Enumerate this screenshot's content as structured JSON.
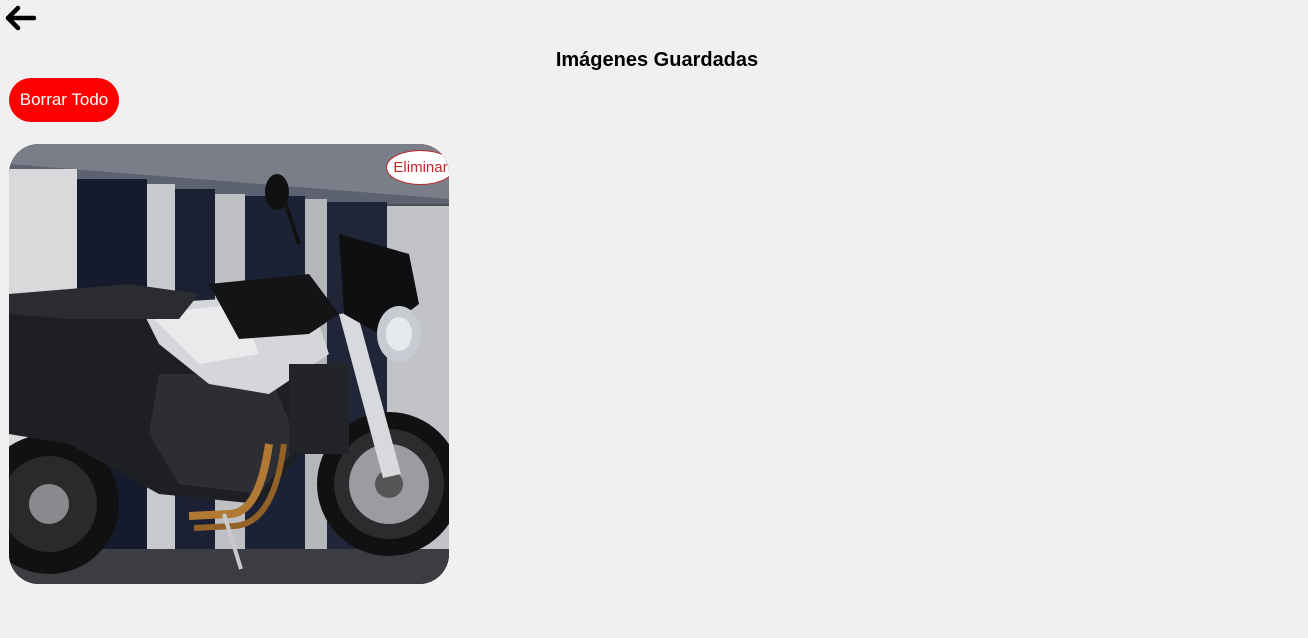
{
  "header": {
    "back_icon": "arrow-left-icon",
    "title": "Imágenes Guardadas"
  },
  "actions": {
    "clear_all_label": "Borrar Todo",
    "clear_all_color": "#ff0000"
  },
  "gallery": {
    "items": [
      {
        "delete_label": "Eliminar",
        "delete_color": "#c0282a"
      }
    ]
  },
  "colors": {
    "background": "#f0f0f0"
  }
}
